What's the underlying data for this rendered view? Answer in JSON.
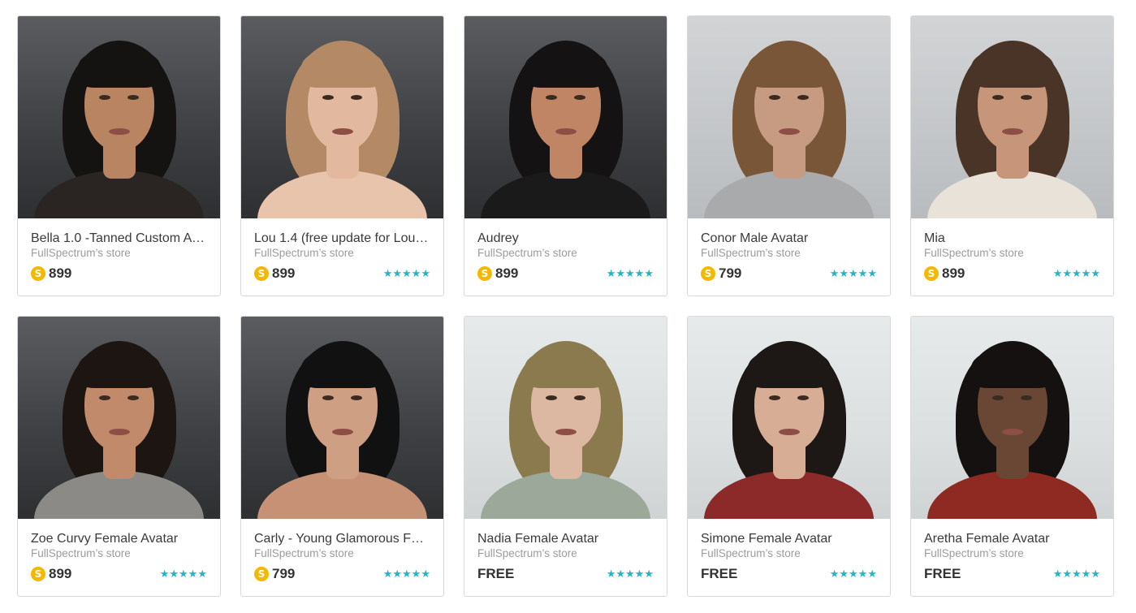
{
  "products": [
    {
      "title": "Bella 1.0 -Tanned Custom Av…",
      "store": "FullSpectrum’s store",
      "price": "899",
      "coin": "S",
      "paid": true,
      "stars": "",
      "bg": "dark",
      "skin": "#b98462",
      "hair": "#151312",
      "cloth": "#2a2522"
    },
    {
      "title": "Lou 1.4 (free update for Lou …",
      "store": "FullSpectrum’s store",
      "price": "899",
      "coin": "S",
      "paid": true,
      "stars": "★★★★★",
      "bg": "dark",
      "skin": "#e2b89f",
      "hair": "#b48a66",
      "cloth": "#e9c4ac"
    },
    {
      "title": "Audrey",
      "store": "FullSpectrum’s store",
      "price": "899",
      "coin": "S",
      "paid": true,
      "stars": "★★★★★",
      "bg": "dark",
      "skin": "#c08565",
      "hair": "#141213",
      "cloth": "#1b1a1a"
    },
    {
      "title": "Conor Male Avatar",
      "store": "FullSpectrum’s store",
      "price": "799",
      "coin": "S",
      "paid": true,
      "stars": "★★★★★",
      "bg": "mid",
      "skin": "#c79b82",
      "hair": "#7a5638",
      "cloth": "#a9aaac"
    },
    {
      "title": "Mia",
      "store": "FullSpectrum’s store",
      "price": "899",
      "coin": "S",
      "paid": true,
      "stars": "★★★★★",
      "bg": "mid",
      "skin": "#c6957a",
      "hair": "#4a3428",
      "cloth": "#e8e2d8"
    },
    {
      "title": "Zoe Curvy Female Avatar",
      "store": "FullSpectrum’s store",
      "price": "899",
      "coin": "S",
      "paid": true,
      "stars": "★★★★★",
      "bg": "dark",
      "skin": "#c08a6b",
      "hair": "#1c1512",
      "cloth": "#8c8a86"
    },
    {
      "title": "Carly - Young Glamorous Fe…",
      "store": "FullSpectrum’s store",
      "price": "799",
      "coin": "S",
      "paid": true,
      "stars": "★★★★★",
      "bg": "dark",
      "skin": "#cf9f84",
      "hair": "#121112",
      "cloth": "#c69175"
    },
    {
      "title": "Nadia Female Avatar",
      "store": "FullSpectrum’s store",
      "price": "FREE",
      "coin": "",
      "paid": false,
      "stars": "★★★★★",
      "bg": "light",
      "skin": "#dcb8a2",
      "hair": "#8a7a4e",
      "cloth": "#9ba89a"
    },
    {
      "title": "Simone Female Avatar",
      "store": "FullSpectrum’s store",
      "price": "FREE",
      "coin": "",
      "paid": false,
      "stars": "★★★★★",
      "bg": "light",
      "skin": "#d8ad96",
      "hair": "#1d1716",
      "cloth": "#8b2a28"
    },
    {
      "title": "Aretha Female Avatar",
      "store": "FullSpectrum’s store",
      "price": "FREE",
      "coin": "",
      "paid": false,
      "stars": "★★★★★",
      "bg": "light",
      "skin": "#6a4634",
      "hair": "#141110",
      "cloth": "#8e2a22"
    }
  ]
}
